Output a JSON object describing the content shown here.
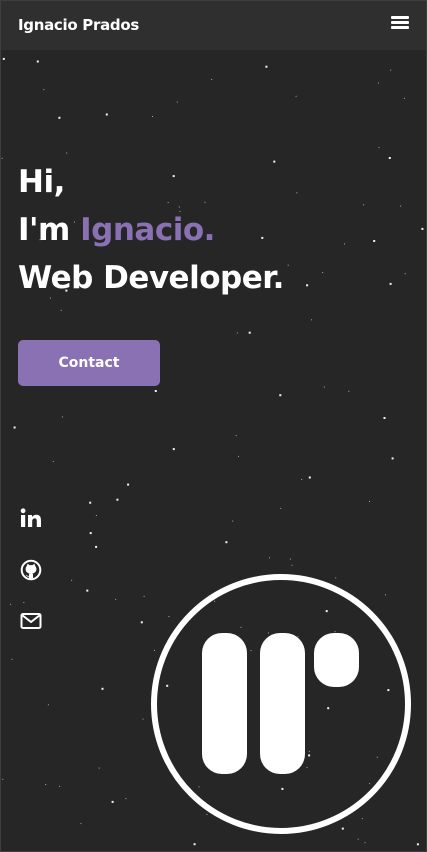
{
  "navbar": {
    "brand": "Ignacio Prados",
    "menu_icon": "hamburger-menu-icon"
  },
  "hero": {
    "greeting": "Hi,",
    "intro_prefix": "I'm",
    "name": "Ignacio.",
    "role": "Web Developer."
  },
  "contact_button": {
    "label": "Contact"
  },
  "socials": [
    {
      "icon": "linkedin-icon"
    },
    {
      "icon": "github-icon"
    },
    {
      "icon": "mail-icon"
    }
  ],
  "logo": {
    "icon": "ip-monogram-logo"
  },
  "colors": {
    "background": "#262626",
    "navbar": "#2f2f2f",
    "accent": "#8a71b3",
    "text": "#ffffff"
  }
}
